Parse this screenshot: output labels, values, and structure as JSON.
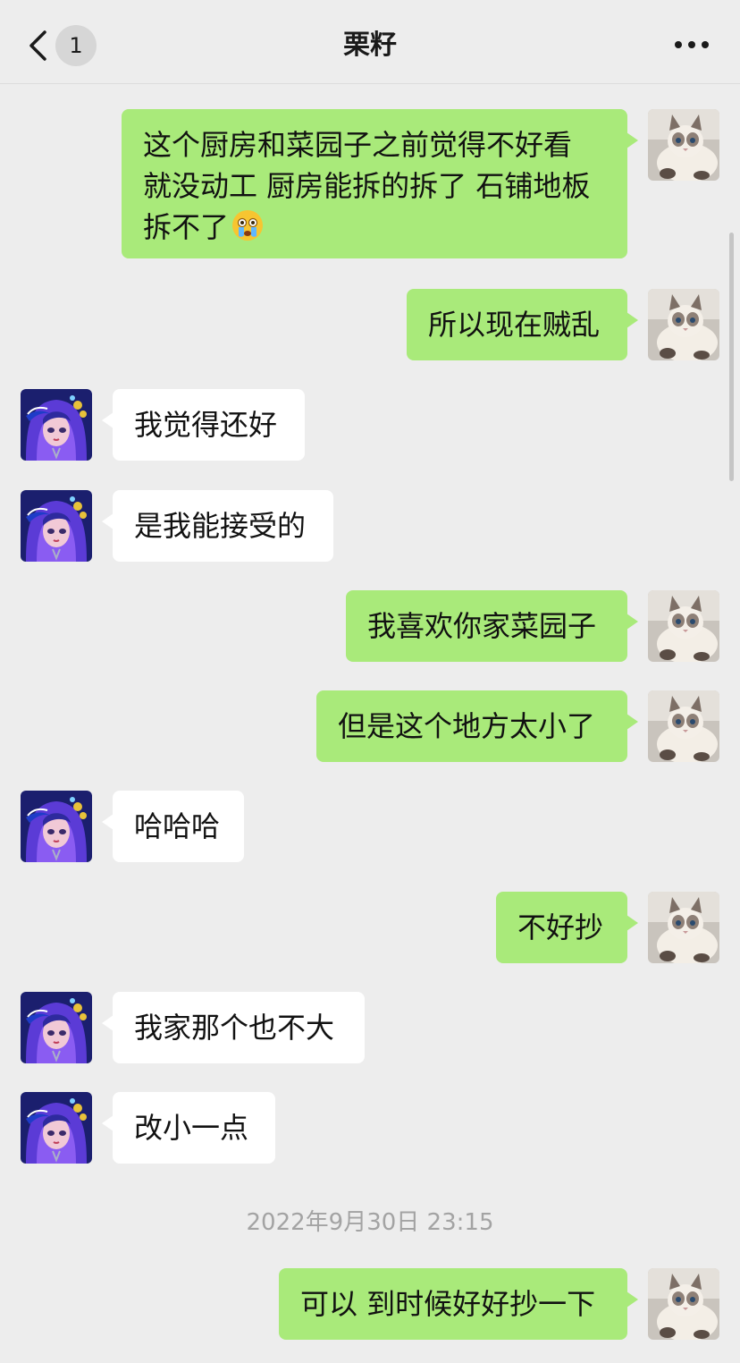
{
  "header": {
    "title": "栗籽",
    "unread_count": "1",
    "back_icon": "chevron-left-icon",
    "more_icon": "more-horizontal-icon"
  },
  "messages": [
    {
      "sender": "me",
      "text": "这个厨房和菜园子之前觉得不好看\n就没动工 厨房能拆的拆了 石铺地板\n拆不了",
      "emoji": "crying-face-emoji"
    },
    {
      "sender": "me",
      "text": "所以现在贼乱"
    },
    {
      "sender": "them",
      "text": "我觉得还好"
    },
    {
      "sender": "them",
      "text": "是我能接受的"
    },
    {
      "sender": "me",
      "text": "我喜欢你家菜园子"
    },
    {
      "sender": "me",
      "text": "但是这个地方太小了"
    },
    {
      "sender": "them",
      "text": "哈哈哈"
    },
    {
      "sender": "me",
      "text": "不好抄"
    },
    {
      "sender": "them",
      "text": "我家那个也不大"
    },
    {
      "sender": "them",
      "text": "改小一点"
    },
    {
      "type": "timestamp",
      "text": "2022年9月30日 23:15"
    },
    {
      "sender": "me",
      "text": "可以 到时候好好抄一下"
    }
  ],
  "avatars": {
    "me": "cat-avatar",
    "them": "anime-girl-avatar"
  },
  "colors": {
    "background": "#ededed",
    "my_bubble": "#a9ea7a",
    "their_bubble": "#ffffff",
    "timestamp_text": "#a3a3a3"
  }
}
